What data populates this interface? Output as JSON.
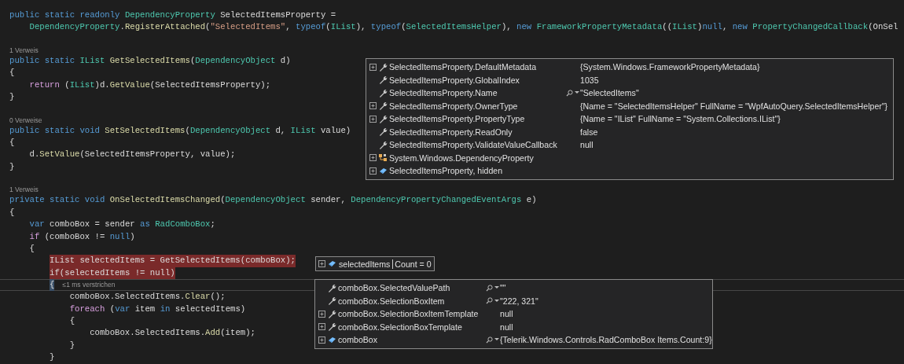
{
  "editor": {
    "lines": [
      {
        "kind": "code",
        "breakpoint": false,
        "current": false,
        "segments": [
          {
            "kind": "keyword",
            "text": "public static readonly "
          },
          {
            "kind": "type",
            "text": "DependencyProperty"
          },
          {
            "kind": "plain",
            "text": " SelectedItemsProperty ="
          }
        ]
      },
      {
        "kind": "code",
        "breakpoint": false,
        "current": false,
        "segments": [
          {
            "kind": "type",
            "text": "    DependencyProperty"
          },
          {
            "kind": "plain",
            "text": "."
          },
          {
            "kind": "method",
            "text": "RegisterAttached"
          },
          {
            "kind": "plain",
            "text": "("
          },
          {
            "kind": "string",
            "text": "\"SelectedItems\""
          },
          {
            "kind": "plain",
            "text": ", "
          },
          {
            "kind": "keyword",
            "text": "typeof"
          },
          {
            "kind": "plain",
            "text": "("
          },
          {
            "kind": "type",
            "text": "IList"
          },
          {
            "kind": "plain",
            "text": "), "
          },
          {
            "kind": "keyword",
            "text": "typeof"
          },
          {
            "kind": "plain",
            "text": "("
          },
          {
            "kind": "type",
            "text": "SelectedItemsHelper"
          },
          {
            "kind": "plain",
            "text": "), "
          },
          {
            "kind": "keyword",
            "text": "new "
          },
          {
            "kind": "type",
            "text": "FrameworkPropertyMetadata"
          },
          {
            "kind": "plain",
            "text": "(("
          },
          {
            "kind": "type",
            "text": "IList"
          },
          {
            "kind": "plain",
            "text": ")"
          },
          {
            "kind": "keyword",
            "text": "null"
          },
          {
            "kind": "plain",
            "text": ", "
          },
          {
            "kind": "keyword",
            "text": "new "
          },
          {
            "kind": "type",
            "text": "PropertyChangedCallback"
          },
          {
            "kind": "plain",
            "text": "(OnSel"
          }
        ]
      },
      {
        "kind": "blank"
      },
      {
        "kind": "codelens",
        "text": "1 Verweis"
      },
      {
        "kind": "code",
        "breakpoint": false,
        "current": false,
        "segments": [
          {
            "kind": "keyword",
            "text": "public static "
          },
          {
            "kind": "type",
            "text": "IList"
          },
          {
            "kind": "method",
            "text": " GetSelectedItems"
          },
          {
            "kind": "plain",
            "text": "("
          },
          {
            "kind": "type",
            "text": "DependencyObject"
          },
          {
            "kind": "plain",
            "text": " d)"
          }
        ]
      },
      {
        "kind": "code",
        "breakpoint": false,
        "current": false,
        "segments": [
          {
            "kind": "plain",
            "text": "{"
          }
        ]
      },
      {
        "kind": "code",
        "breakpoint": false,
        "current": false,
        "segments": [
          {
            "kind": "control",
            "text": "    return"
          },
          {
            "kind": "plain",
            "text": " ("
          },
          {
            "kind": "type",
            "text": "IList"
          },
          {
            "kind": "plain",
            "text": ")d."
          },
          {
            "kind": "method",
            "text": "GetValue"
          },
          {
            "kind": "plain",
            "text": "(SelectedItemsProperty);"
          }
        ]
      },
      {
        "kind": "code",
        "breakpoint": false,
        "current": false,
        "segments": [
          {
            "kind": "plain",
            "text": "}"
          }
        ]
      },
      {
        "kind": "blank"
      },
      {
        "kind": "codelens",
        "text": "0 Verweise"
      },
      {
        "kind": "code",
        "breakpoint": false,
        "current": false,
        "segments": [
          {
            "kind": "keyword",
            "text": "public static void "
          },
          {
            "kind": "method",
            "text": "SetSelectedItems"
          },
          {
            "kind": "plain",
            "text": "("
          },
          {
            "kind": "type",
            "text": "DependencyObject"
          },
          {
            "kind": "plain",
            "text": " d, "
          },
          {
            "kind": "type",
            "text": "IList"
          },
          {
            "kind": "plain",
            "text": " value)"
          }
        ]
      },
      {
        "kind": "code",
        "breakpoint": false,
        "current": false,
        "segments": [
          {
            "kind": "plain",
            "text": "{"
          }
        ]
      },
      {
        "kind": "code",
        "breakpoint": false,
        "current": false,
        "segments": [
          {
            "kind": "plain",
            "text": "    d."
          },
          {
            "kind": "method",
            "text": "SetValue"
          },
          {
            "kind": "plain",
            "text": "(SelectedItemsProperty, value);"
          }
        ]
      },
      {
        "kind": "code",
        "breakpoint": false,
        "current": false,
        "segments": [
          {
            "kind": "plain",
            "text": "}"
          }
        ]
      },
      {
        "kind": "blank"
      },
      {
        "kind": "codelens",
        "text": "1 Verweis"
      },
      {
        "kind": "code",
        "breakpoint": false,
        "current": false,
        "segments": [
          {
            "kind": "keyword",
            "text": "private static void "
          },
          {
            "kind": "method",
            "text": "OnSelectedItemsChanged"
          },
          {
            "kind": "plain",
            "text": "("
          },
          {
            "kind": "type",
            "text": "DependencyObject"
          },
          {
            "kind": "plain",
            "text": " sender, "
          },
          {
            "kind": "type",
            "text": "DependencyPropertyChangedEventArgs"
          },
          {
            "kind": "plain",
            "text": " e)"
          }
        ]
      },
      {
        "kind": "code",
        "breakpoint": false,
        "current": false,
        "segments": [
          {
            "kind": "plain",
            "text": "{"
          }
        ]
      },
      {
        "kind": "code",
        "breakpoint": false,
        "current": false,
        "segments": [
          {
            "kind": "keyword",
            "text": "    var"
          },
          {
            "kind": "plain",
            "text": " comboBox = sender "
          },
          {
            "kind": "keyword",
            "text": "as "
          },
          {
            "kind": "type",
            "text": "RadComboBox"
          },
          {
            "kind": "plain",
            "text": ";"
          }
        ]
      },
      {
        "kind": "code",
        "breakpoint": false,
        "current": false,
        "segments": [
          {
            "kind": "control",
            "text": "    if"
          },
          {
            "kind": "plain",
            "text": " (comboBox != "
          },
          {
            "kind": "keyword",
            "text": "null"
          },
          {
            "kind": "plain",
            "text": ")"
          }
        ]
      },
      {
        "kind": "code",
        "breakpoint": false,
        "current": false,
        "segments": [
          {
            "kind": "plain",
            "text": "    {"
          }
        ]
      },
      {
        "kind": "code",
        "breakpoint": true,
        "current": false,
        "segments": [
          {
            "kind": "plain",
            "text": "        IList selectedItems = GetSelectedItems(comboBox);"
          }
        ]
      },
      {
        "kind": "code",
        "breakpoint": true,
        "current": false,
        "segments": [
          {
            "kind": "plain",
            "text": "        if(selectedItems != null)"
          }
        ]
      },
      {
        "kind": "code",
        "breakpoint": false,
        "current": true,
        "perf_tip": "≤1 ms verstrichen",
        "segments": [
          {
            "kind": "plain",
            "text": "        {"
          }
        ]
      },
      {
        "kind": "code",
        "breakpoint": false,
        "current": false,
        "segments": [
          {
            "kind": "plain",
            "text": "            comboBox.SelectedItems."
          },
          {
            "kind": "method",
            "text": "Clear"
          },
          {
            "kind": "plain",
            "text": "();"
          }
        ]
      },
      {
        "kind": "code",
        "breakpoint": false,
        "current": false,
        "segments": [
          {
            "kind": "control",
            "text": "            foreach"
          },
          {
            "kind": "plain",
            "text": " ("
          },
          {
            "kind": "keyword",
            "text": "var"
          },
          {
            "kind": "plain",
            "text": " item "
          },
          {
            "kind": "keyword",
            "text": "in"
          },
          {
            "kind": "plain",
            "text": " selectedItems)"
          }
        ]
      },
      {
        "kind": "code",
        "breakpoint": false,
        "current": false,
        "segments": [
          {
            "kind": "plain",
            "text": "            {"
          }
        ]
      },
      {
        "kind": "code",
        "breakpoint": false,
        "current": false,
        "segments": [
          {
            "kind": "plain",
            "text": "                comboBox.SelectedItems."
          },
          {
            "kind": "method",
            "text": "Add"
          },
          {
            "kind": "plain",
            "text": "(item);"
          }
        ]
      },
      {
        "kind": "code",
        "breakpoint": false,
        "current": false,
        "segments": [
          {
            "kind": "plain",
            "text": "            }"
          }
        ]
      },
      {
        "kind": "code",
        "breakpoint": false,
        "current": false,
        "segments": [
          {
            "kind": "plain",
            "text": "        }"
          }
        ]
      }
    ]
  },
  "datatips": [
    {
      "kind": "panel",
      "rows": [
        {
          "expandable": true,
          "kind": "property",
          "name": "SelectedItemsProperty.DefaultMetadata",
          "visualizer": false,
          "value": "{System.Windows.FrameworkPropertyMetadata}"
        },
        {
          "expandable": false,
          "kind": "property",
          "name": "SelectedItemsProperty.GlobalIndex",
          "visualizer": false,
          "value": "1035"
        },
        {
          "expandable": false,
          "kind": "property",
          "name": "SelectedItemsProperty.Name",
          "visualizer": true,
          "value": "\"SelectedItems\""
        },
        {
          "expandable": true,
          "kind": "property",
          "name": "SelectedItemsProperty.OwnerType",
          "visualizer": false,
          "value": "{Name = \"SelectedItemsHelper\" FullName = \"WpfAutoQuery.SelectedItemsHelper\"}"
        },
        {
          "expandable": true,
          "kind": "property",
          "name": "SelectedItemsProperty.PropertyType",
          "visualizer": false,
          "value": "{Name = \"IList\" FullName = \"System.Collections.IList\"}"
        },
        {
          "expandable": false,
          "kind": "property",
          "name": "SelectedItemsProperty.ReadOnly",
          "visualizer": false,
          "value": "false"
        },
        {
          "expandable": false,
          "kind": "property",
          "name": "SelectedItemsProperty.ValidateValueCallback",
          "visualizer": false,
          "value": "null"
        },
        {
          "expandable": true,
          "kind": "base",
          "name": "System.Windows.DependencyProperty",
          "visualizer": false
        },
        {
          "expandable": true,
          "kind": "object",
          "name": "SelectedItemsProperty, hidden",
          "visualizer": false
        }
      ]
    },
    {
      "kind": "inline",
      "rows": [
        {
          "expandable": true,
          "kind": "object",
          "name": "selectedItems",
          "visualizer": false,
          "value": "Count = 0"
        }
      ]
    },
    {
      "kind": "panel",
      "rows": [
        {
          "expandable": false,
          "kind": "property",
          "name": "comboBox.SelectedValuePath",
          "visualizer": true,
          "value": "\"\""
        },
        {
          "expandable": false,
          "kind": "property",
          "name": "comboBox.SelectionBoxItem",
          "visualizer": true,
          "value": "\"222, 321\""
        },
        {
          "expandable": true,
          "kind": "property",
          "name": "comboBox.SelectionBoxItemTemplate",
          "visualizer": false,
          "value": "null"
        },
        {
          "expandable": true,
          "kind": "property",
          "name": "comboBox.SelectionBoxTemplate",
          "visualizer": false,
          "value": "null"
        },
        {
          "expandable": true,
          "kind": "object",
          "name": "comboBox",
          "visualizer": true,
          "value": "{Telerik.Windows.Controls.RadComboBox Items.Count:9}"
        }
      ]
    }
  ]
}
